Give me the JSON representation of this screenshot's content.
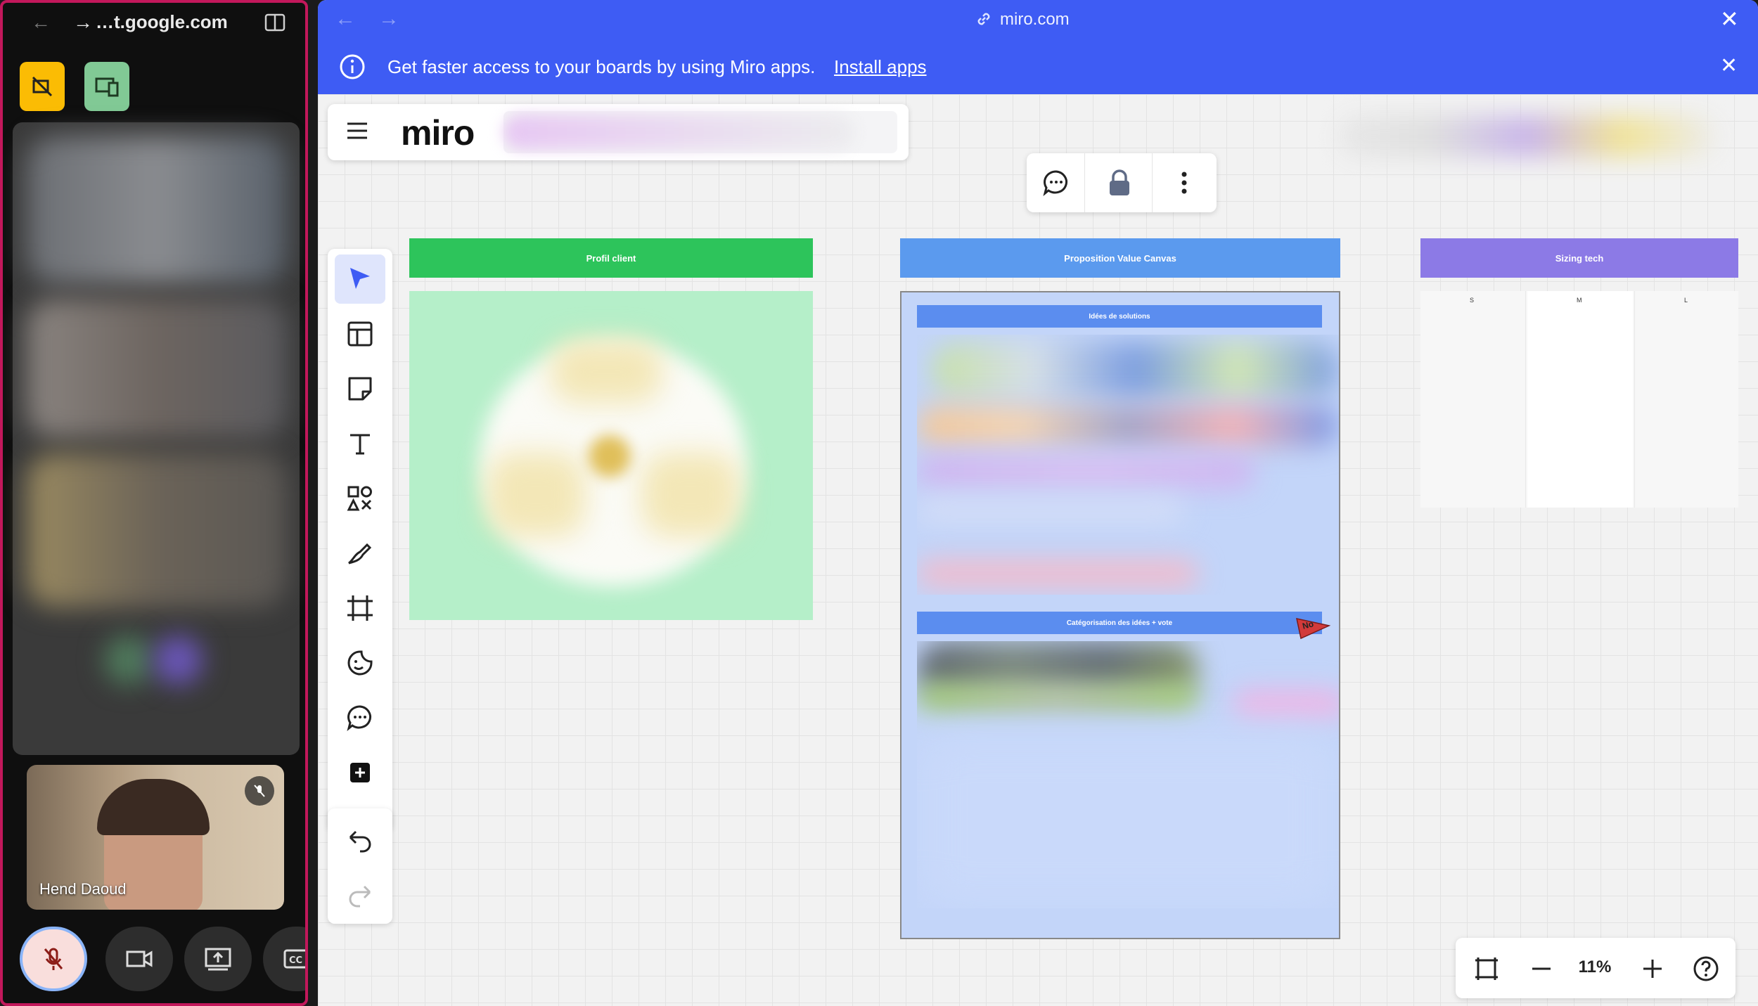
{
  "meet": {
    "url": "…t.google.com",
    "participant_name": "Hend Daoud",
    "colors": {
      "border": "#c2185b",
      "yellow_button": "#fbbc04",
      "green_button": "#81c995"
    }
  },
  "miro": {
    "url": "miro.com",
    "banner_message": "Get faster access to your boards by using Miro apps.",
    "banner_link": "Install apps",
    "logo": "miro",
    "zoom": "11%",
    "frames": {
      "profil": "Profil client",
      "proposition": "Proposition Value Canvas",
      "sizing": "Sizing tech",
      "ideas": "Idées de solutions",
      "categorisation": "Catégorisation des idées + vote",
      "sizing_cols": [
        "S",
        "M",
        "L"
      ],
      "no_sticker": "No"
    },
    "colors": {
      "accent": "#3e5cf4",
      "green_header": "#2dc45b",
      "blue_header": "#5b9aee",
      "purple_header": "#8c7ae6"
    }
  }
}
